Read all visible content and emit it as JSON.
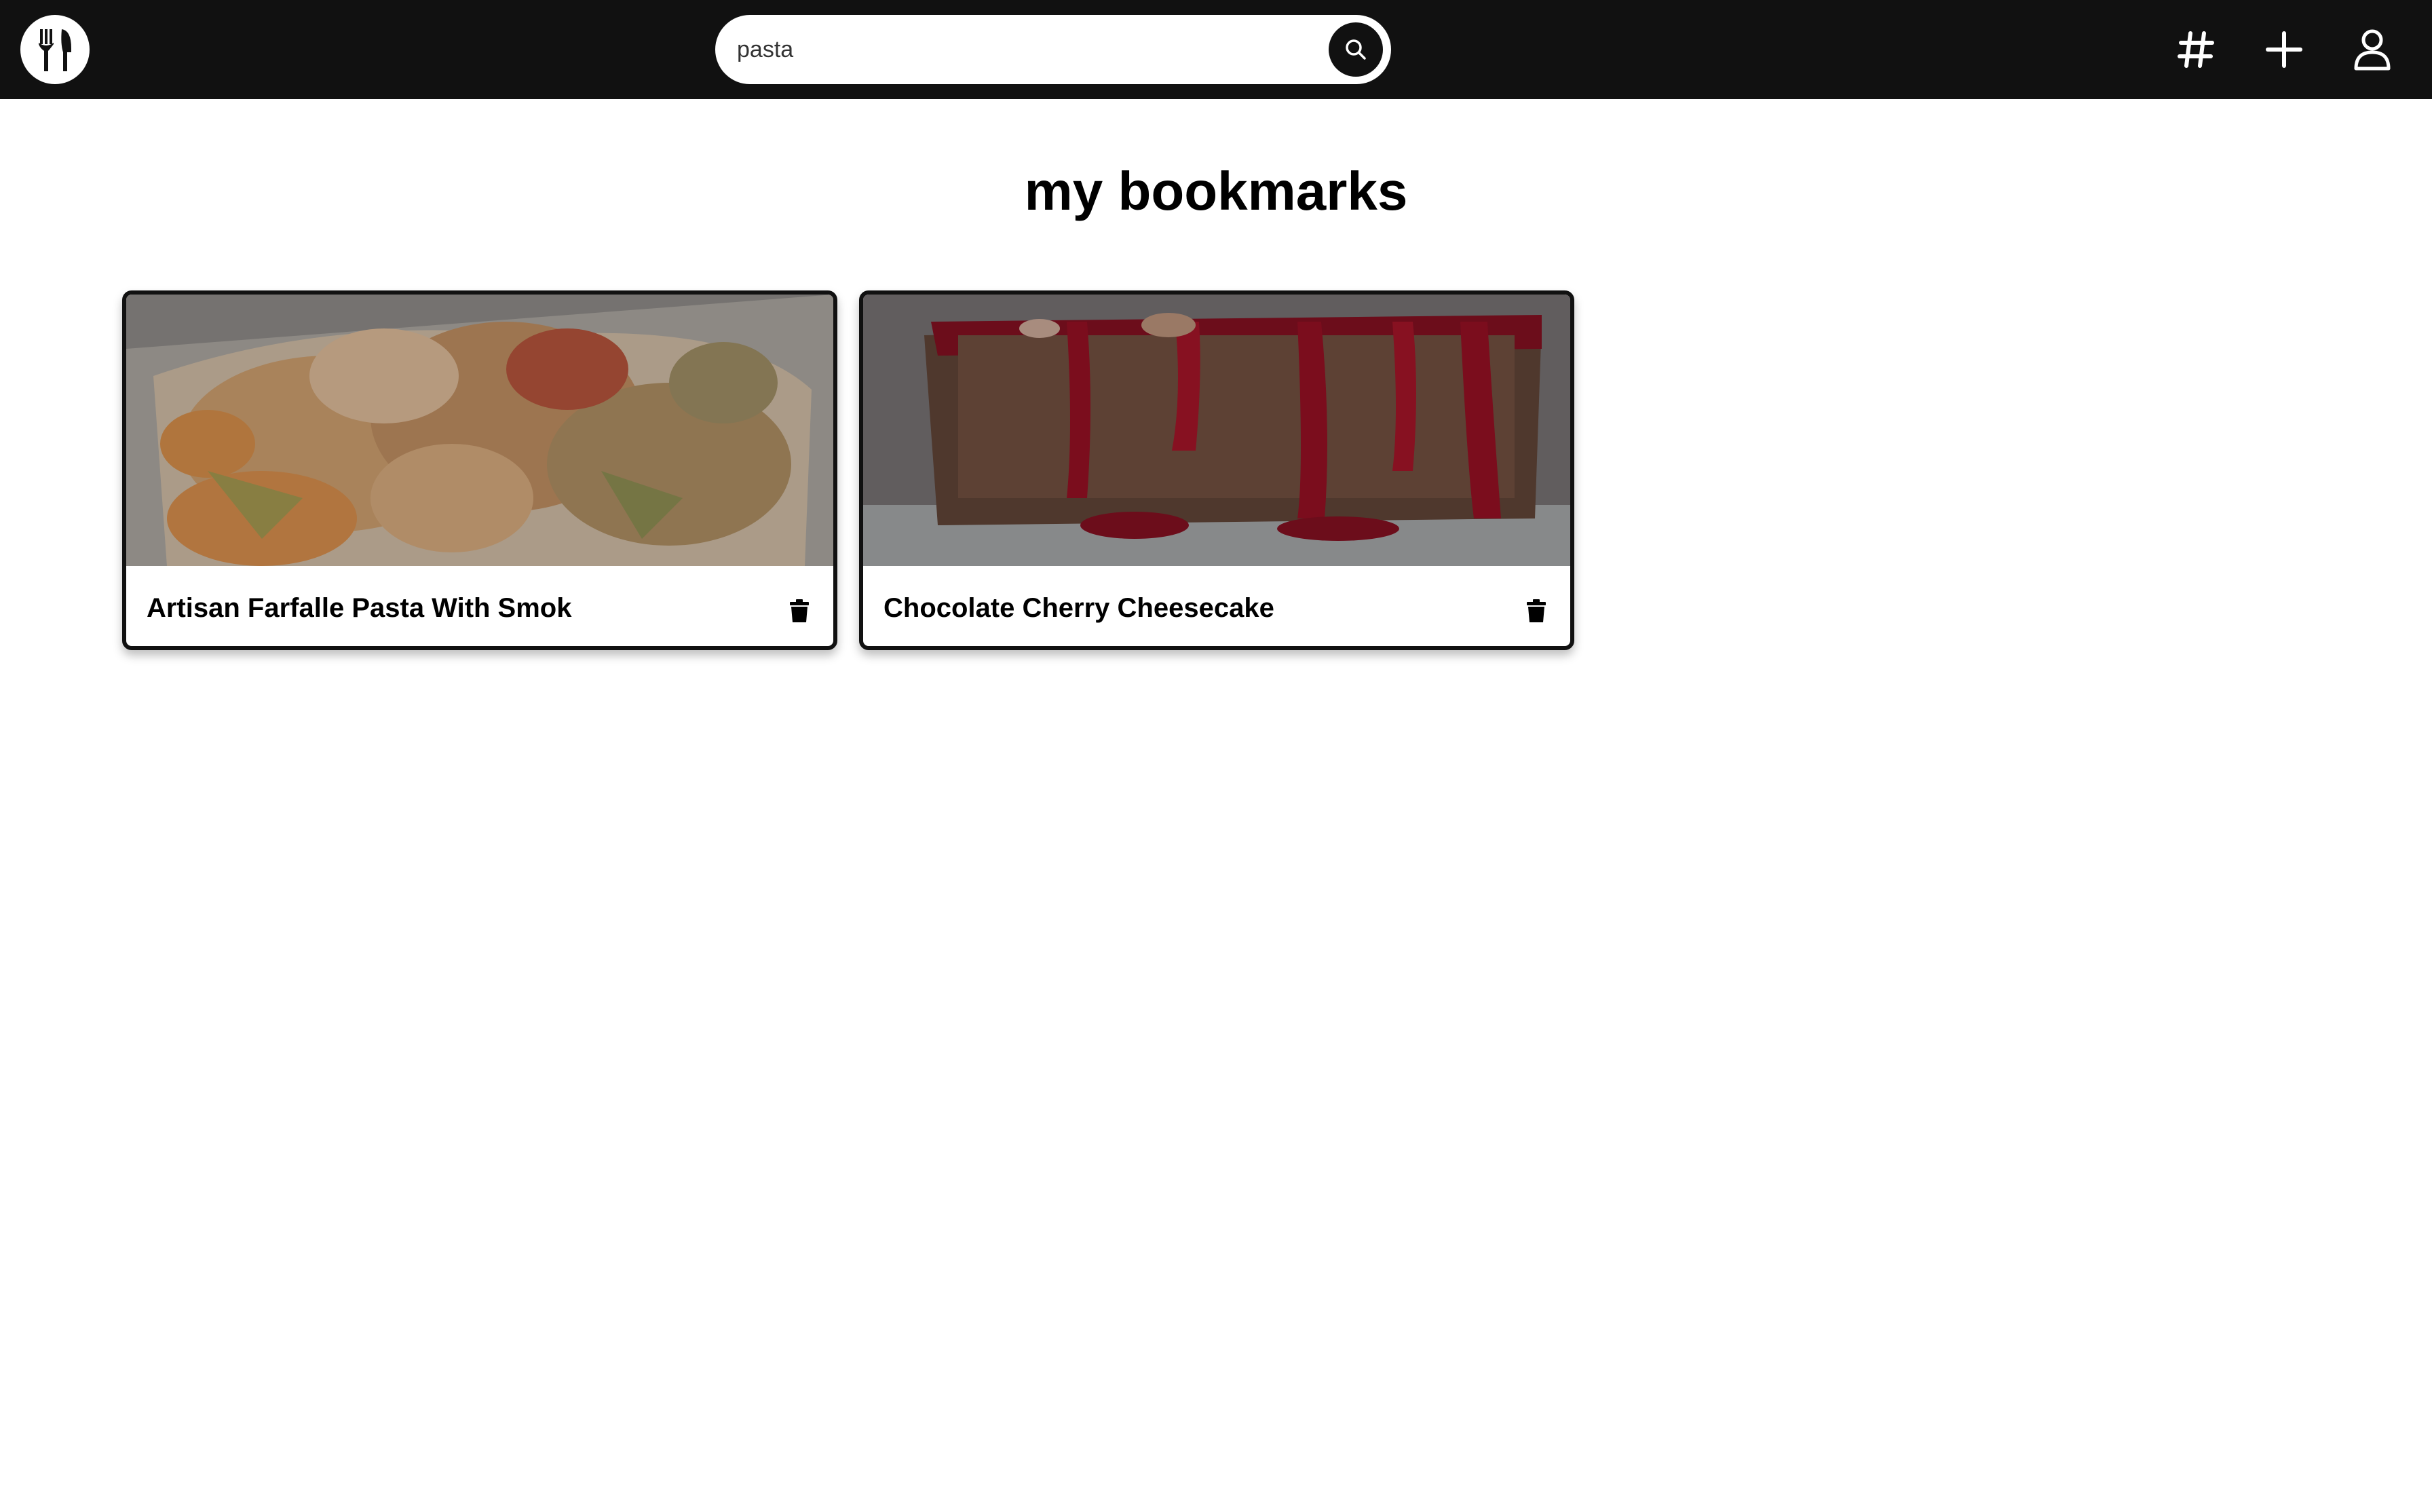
{
  "search": {
    "value": "pasta",
    "placeholder": ""
  },
  "page": {
    "title": "my bookmarks"
  },
  "nav": {
    "icons": [
      "hashtag-icon",
      "plus-icon",
      "user-icon"
    ]
  },
  "bookmarks": [
    {
      "title": "Artisan Farfalle Pasta With Smok",
      "image": "farfalle-pasta-photo"
    },
    {
      "title": "Chocolate Cherry Cheesecake",
      "image": "chocolate-cherry-cheesecake-photo"
    }
  ],
  "colors": {
    "topbar": "#111111",
    "background": "#ffffff",
    "card_border": "#111111"
  }
}
